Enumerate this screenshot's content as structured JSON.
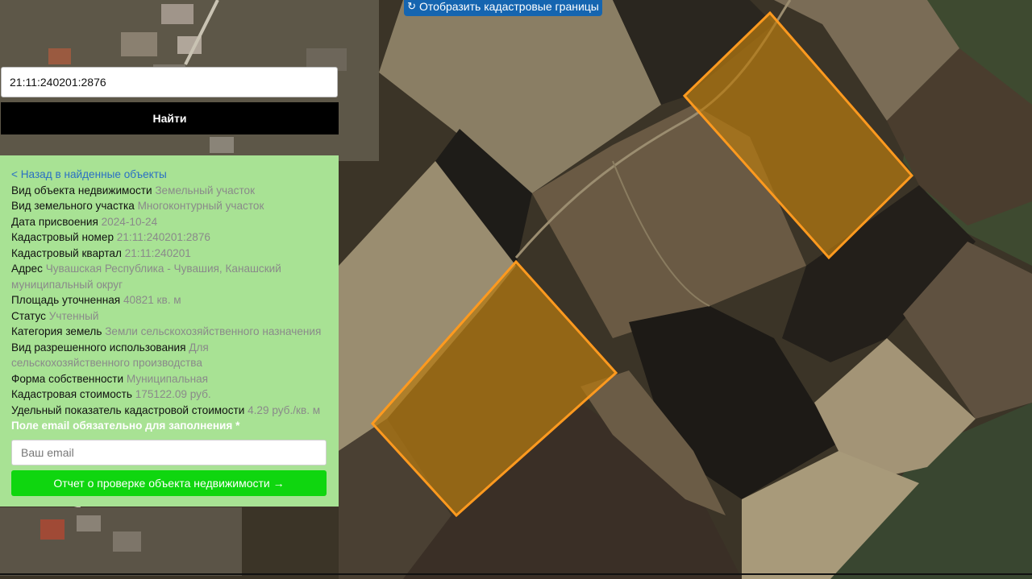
{
  "map": {
    "type": "satellite-map",
    "highlighted_parcels": 2,
    "parcel_outline_color": "#ff9a1f",
    "parcel_fill_color": "#b57a10"
  },
  "top_button": {
    "label": "Отобразить кадастровые границы",
    "icon": "refresh-icon"
  },
  "search": {
    "value": "21:11:240201:2876",
    "button_label": "Найти"
  },
  "panel": {
    "back_link": "< Назад в найденные объекты",
    "rows": [
      {
        "label": "Вид объекта недвижимости",
        "value": "Земельный участок"
      },
      {
        "label": "Вид земельного участка",
        "value": "Многоконтурный участок"
      },
      {
        "label": "Дата присвоения",
        "value": "2024-10-24"
      },
      {
        "label": "Кадастровый номер",
        "value": "21:11:240201:2876"
      },
      {
        "label": "Кадастровый квартал",
        "value": "21:11:240201"
      },
      {
        "label": "Адрес",
        "value": "Чувашская Республика - Чувашия, Канашский муниципальный округ"
      },
      {
        "label": "Площадь уточненная",
        "value": "40821 кв. м"
      },
      {
        "label": "Статус",
        "value": "Учтенный"
      },
      {
        "label": "Категория земель",
        "value": "Земли сельскохозяйственного назначения"
      },
      {
        "label": "Вид разрешенного использования",
        "value": "Для сельскохозяйственного производства"
      },
      {
        "label": "Форма собственности",
        "value": "Муниципальная"
      },
      {
        "label": "Кадастровая стоимость",
        "value": "175122.09 руб."
      },
      {
        "label": "Удельный показатель кадастровой стоимости",
        "value": "4.29 руб./кв. м"
      }
    ],
    "required_note": "Поле email обязательно для заполнения *",
    "email_placeholder": "Ваш email",
    "report_button": "Отчет о проверке объекта недвижимости →"
  }
}
